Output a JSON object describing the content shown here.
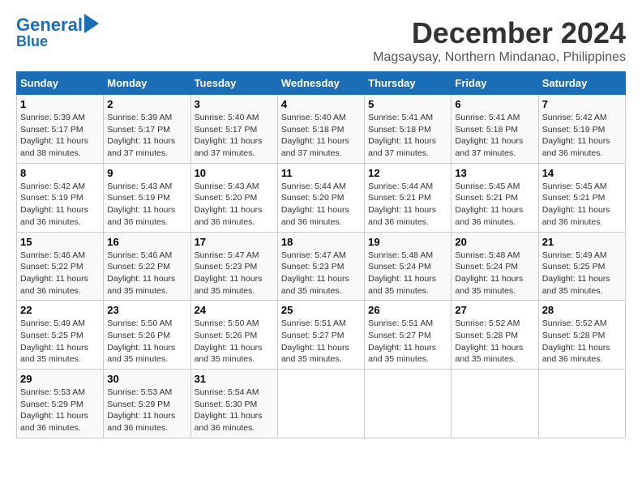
{
  "logo": {
    "line1": "General",
    "line2": "Blue",
    "arrow": true
  },
  "title": "December 2024",
  "location": "Magsaysay, Northern Mindanao, Philippines",
  "days_of_week": [
    "Sunday",
    "Monday",
    "Tuesday",
    "Wednesday",
    "Thursday",
    "Friday",
    "Saturday"
  ],
  "weeks": [
    [
      {
        "day": "1",
        "sunrise": "5:39 AM",
        "sunset": "5:17 PM",
        "daylight": "11 hours and 38 minutes."
      },
      {
        "day": "2",
        "sunrise": "5:39 AM",
        "sunset": "5:17 PM",
        "daylight": "11 hours and 37 minutes."
      },
      {
        "day": "3",
        "sunrise": "5:40 AM",
        "sunset": "5:17 PM",
        "daylight": "11 hours and 37 minutes."
      },
      {
        "day": "4",
        "sunrise": "5:40 AM",
        "sunset": "5:18 PM",
        "daylight": "11 hours and 37 minutes."
      },
      {
        "day": "5",
        "sunrise": "5:41 AM",
        "sunset": "5:18 PM",
        "daylight": "11 hours and 37 minutes."
      },
      {
        "day": "6",
        "sunrise": "5:41 AM",
        "sunset": "5:18 PM",
        "daylight": "11 hours and 37 minutes."
      },
      {
        "day": "7",
        "sunrise": "5:42 AM",
        "sunset": "5:19 PM",
        "daylight": "11 hours and 36 minutes."
      }
    ],
    [
      {
        "day": "8",
        "sunrise": "5:42 AM",
        "sunset": "5:19 PM",
        "daylight": "11 hours and 36 minutes."
      },
      {
        "day": "9",
        "sunrise": "5:43 AM",
        "sunset": "5:19 PM",
        "daylight": "11 hours and 36 minutes."
      },
      {
        "day": "10",
        "sunrise": "5:43 AM",
        "sunset": "5:20 PM",
        "daylight": "11 hours and 36 minutes."
      },
      {
        "day": "11",
        "sunrise": "5:44 AM",
        "sunset": "5:20 PM",
        "daylight": "11 hours and 36 minutes."
      },
      {
        "day": "12",
        "sunrise": "5:44 AM",
        "sunset": "5:21 PM",
        "daylight": "11 hours and 36 minutes."
      },
      {
        "day": "13",
        "sunrise": "5:45 AM",
        "sunset": "5:21 PM",
        "daylight": "11 hours and 36 minutes."
      },
      {
        "day": "14",
        "sunrise": "5:45 AM",
        "sunset": "5:21 PM",
        "daylight": "11 hours and 36 minutes."
      }
    ],
    [
      {
        "day": "15",
        "sunrise": "5:46 AM",
        "sunset": "5:22 PM",
        "daylight": "11 hours and 36 minutes."
      },
      {
        "day": "16",
        "sunrise": "5:46 AM",
        "sunset": "5:22 PM",
        "daylight": "11 hours and 35 minutes."
      },
      {
        "day": "17",
        "sunrise": "5:47 AM",
        "sunset": "5:23 PM",
        "daylight": "11 hours and 35 minutes."
      },
      {
        "day": "18",
        "sunrise": "5:47 AM",
        "sunset": "5:23 PM",
        "daylight": "11 hours and 35 minutes."
      },
      {
        "day": "19",
        "sunrise": "5:48 AM",
        "sunset": "5:24 PM",
        "daylight": "11 hours and 35 minutes."
      },
      {
        "day": "20",
        "sunrise": "5:48 AM",
        "sunset": "5:24 PM",
        "daylight": "11 hours and 35 minutes."
      },
      {
        "day": "21",
        "sunrise": "5:49 AM",
        "sunset": "5:25 PM",
        "daylight": "11 hours and 35 minutes."
      }
    ],
    [
      {
        "day": "22",
        "sunrise": "5:49 AM",
        "sunset": "5:25 PM",
        "daylight": "11 hours and 35 minutes."
      },
      {
        "day": "23",
        "sunrise": "5:50 AM",
        "sunset": "5:26 PM",
        "daylight": "11 hours and 35 minutes."
      },
      {
        "day": "24",
        "sunrise": "5:50 AM",
        "sunset": "5:26 PM",
        "daylight": "11 hours and 35 minutes."
      },
      {
        "day": "25",
        "sunrise": "5:51 AM",
        "sunset": "5:27 PM",
        "daylight": "11 hours and 35 minutes."
      },
      {
        "day": "26",
        "sunrise": "5:51 AM",
        "sunset": "5:27 PM",
        "daylight": "11 hours and 35 minutes."
      },
      {
        "day": "27",
        "sunrise": "5:52 AM",
        "sunset": "5:28 PM",
        "daylight": "11 hours and 35 minutes."
      },
      {
        "day": "28",
        "sunrise": "5:52 AM",
        "sunset": "5:28 PM",
        "daylight": "11 hours and 36 minutes."
      }
    ],
    [
      {
        "day": "29",
        "sunrise": "5:53 AM",
        "sunset": "5:29 PM",
        "daylight": "11 hours and 36 minutes."
      },
      {
        "day": "30",
        "sunrise": "5:53 AM",
        "sunset": "5:29 PM",
        "daylight": "11 hours and 36 minutes."
      },
      {
        "day": "31",
        "sunrise": "5:54 AM",
        "sunset": "5:30 PM",
        "daylight": "11 hours and 36 minutes."
      },
      null,
      null,
      null,
      null
    ]
  ]
}
